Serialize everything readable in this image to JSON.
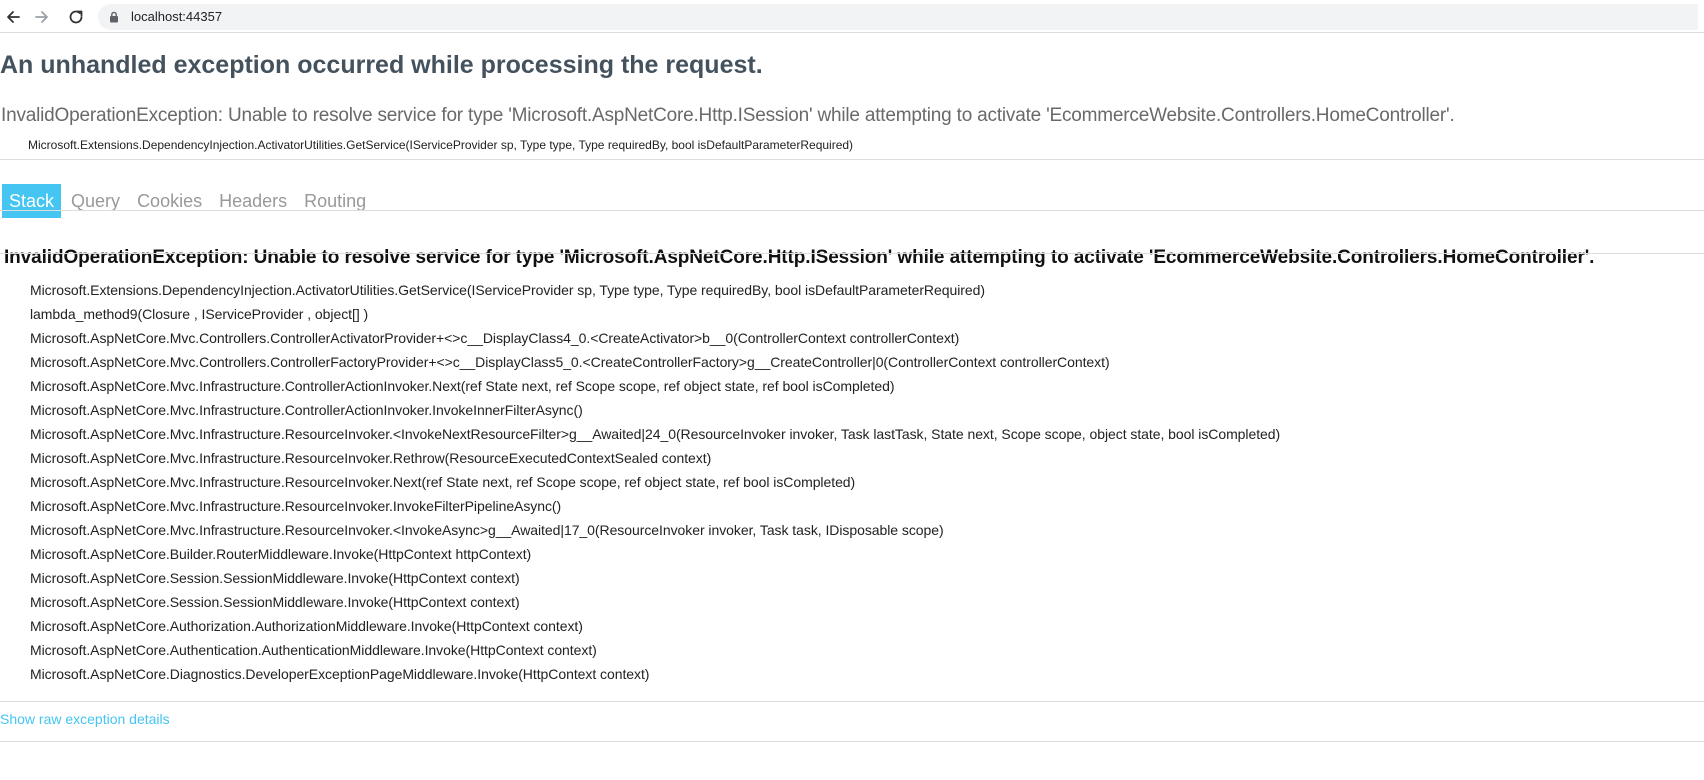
{
  "browser": {
    "url": "localhost:44357",
    "icons": {
      "back": "arrow-left-icon",
      "forward": "arrow-right-icon",
      "reload": "reload-icon",
      "lock": "lock-icon"
    }
  },
  "error": {
    "title": "An unhandled exception occurred while processing the request.",
    "message": "InvalidOperationException: Unable to resolve service for type 'Microsoft.AspNetCore.Http.ISession' while attempting to activate 'EcommerceWebsite.Controllers.HomeController'.",
    "location": "Microsoft.Extensions.DependencyInjection.ActivatorUtilities.GetService(IServiceProvider sp, Type type, Type requiredBy, bool isDefaultParameterRequired)"
  },
  "tabs": [
    {
      "label": "Stack",
      "active": true
    },
    {
      "label": "Query",
      "active": false
    },
    {
      "label": "Cookies",
      "active": false
    },
    {
      "label": "Headers",
      "active": false
    },
    {
      "label": "Routing",
      "active": false
    }
  ],
  "stack": {
    "heading": "InvalidOperationException: Unable to resolve service for type 'Microsoft.AspNetCore.Http.ISession' while attempting to activate 'EcommerceWebsite.Controllers.HomeController'.",
    "frames": [
      "Microsoft.Extensions.DependencyInjection.ActivatorUtilities.GetService(IServiceProvider sp, Type type, Type requiredBy, bool isDefaultParameterRequired)",
      "lambda_method9(Closure , IServiceProvider , object[] )",
      "Microsoft.AspNetCore.Mvc.Controllers.ControllerActivatorProvider+<>c__DisplayClass4_0.<CreateActivator>b__0(ControllerContext controllerContext)",
      "Microsoft.AspNetCore.Mvc.Controllers.ControllerFactoryProvider+<>c__DisplayClass5_0.<CreateControllerFactory>g__CreateController|0(ControllerContext controllerContext)",
      "Microsoft.AspNetCore.Mvc.Infrastructure.ControllerActionInvoker.Next(ref State next, ref Scope scope, ref object state, ref bool isCompleted)",
      "Microsoft.AspNetCore.Mvc.Infrastructure.ControllerActionInvoker.InvokeInnerFilterAsync()",
      "Microsoft.AspNetCore.Mvc.Infrastructure.ResourceInvoker.<InvokeNextResourceFilter>g__Awaited|24_0(ResourceInvoker invoker, Task lastTask, State next, Scope scope, object state, bool isCompleted)",
      "Microsoft.AspNetCore.Mvc.Infrastructure.ResourceInvoker.Rethrow(ResourceExecutedContextSealed context)",
      "Microsoft.AspNetCore.Mvc.Infrastructure.ResourceInvoker.Next(ref State next, ref Scope scope, ref object state, ref bool isCompleted)",
      "Microsoft.AspNetCore.Mvc.Infrastructure.ResourceInvoker.InvokeFilterPipelineAsync()",
      "Microsoft.AspNetCore.Mvc.Infrastructure.ResourceInvoker.<InvokeAsync>g__Awaited|17_0(ResourceInvoker invoker, Task task, IDisposable scope)",
      "Microsoft.AspNetCore.Builder.RouterMiddleware.Invoke(HttpContext httpContext)",
      "Microsoft.AspNetCore.Session.SessionMiddleware.Invoke(HttpContext context)",
      "Microsoft.AspNetCore.Session.SessionMiddleware.Invoke(HttpContext context)",
      "Microsoft.AspNetCore.Authorization.AuthorizationMiddleware.Invoke(HttpContext context)",
      "Microsoft.AspNetCore.Authentication.AuthenticationMiddleware.Invoke(HttpContext context)",
      "Microsoft.AspNetCore.Diagnostics.DeveloperExceptionPageMiddleware.Invoke(HttpContext context)"
    ]
  },
  "raw_link_label": "Show raw exception details",
  "colors": {
    "accent": "#44c5f2",
    "title": "#44525e",
    "muted": "#999999"
  }
}
